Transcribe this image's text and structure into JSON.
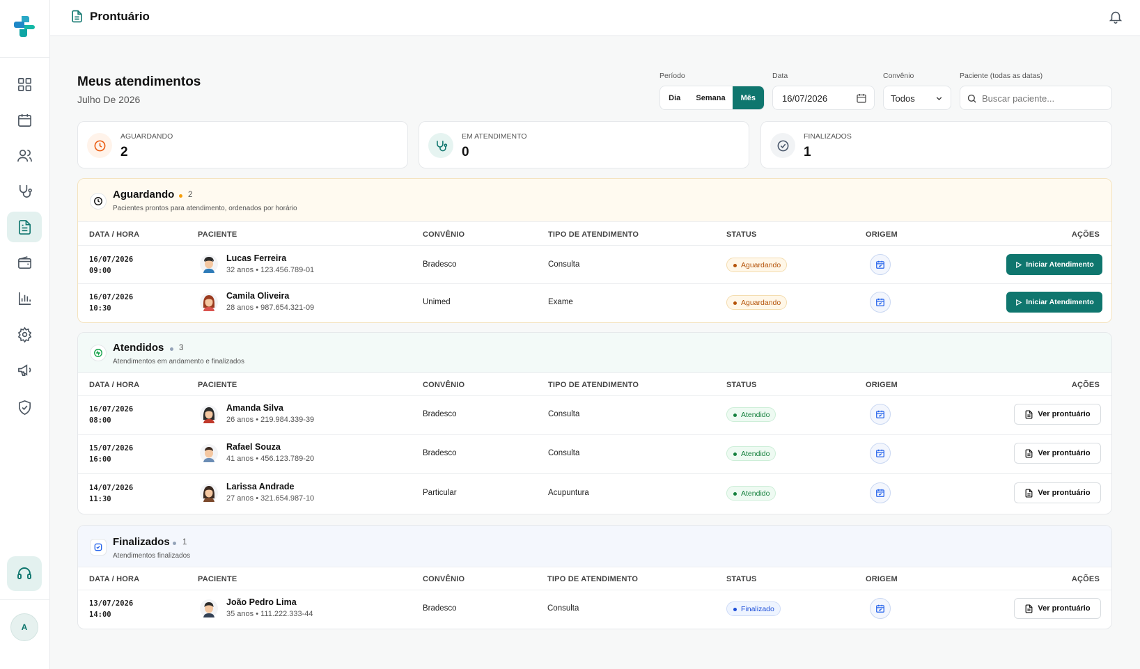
{
  "topbar": {
    "title": "Prontuário"
  },
  "sidebar": {
    "items": [
      "dashboard",
      "agenda",
      "pacientes",
      "atendimentos",
      "prontuario",
      "financeiro",
      "relatorios",
      "configuracoes",
      "campanhas",
      "seguranca"
    ],
    "avatar_initial": "A"
  },
  "header": {
    "title": "Meus atendimentos",
    "subtitle": "Julho De 2026"
  },
  "filters": {
    "periodo_label": "Período",
    "periodo_options": [
      "Dia",
      "Semana",
      "Mês"
    ],
    "periodo_selected": "Mês",
    "data_label": "Data",
    "data_value": "16/07/2026",
    "convenio_label": "Convênio",
    "convenio_value": "Todos",
    "paciente_label": "Paciente (todas as datas)",
    "paciente_placeholder": "Buscar paciente..."
  },
  "stats": [
    {
      "label": "AGUARDANDO",
      "value": "2",
      "color": "#ea580c"
    },
    {
      "label": "EM ATENDIMENTO",
      "value": "0",
      "color": "#0f766e"
    },
    {
      "label": "FINALIZADOS",
      "value": "1",
      "color": "#475569"
    }
  ],
  "columns": [
    "DATA / HORA",
    "PACIENTE",
    "CONVÊNIO",
    "TIPO DE ATENDIMENTO",
    "STATUS",
    "ORIGEM",
    "AÇÕES"
  ],
  "sections": [
    {
      "title": "Aguardando",
      "count": "2",
      "subtitle": "Pacientes prontos para atendimento, ordenados por horário",
      "rows": [
        {
          "date": "16/07/2026",
          "time": "09:00",
          "name": "Lucas Ferreira",
          "meta": "32 anos • 123.456.789-01",
          "convenio": "Bradesco",
          "tipo": "Consulta",
          "status": "Aguardando",
          "action": "Iniciar Atendimento"
        },
        {
          "date": "16/07/2026",
          "time": "10:30",
          "name": "Camila Oliveira",
          "meta": "28 anos • 987.654.321-09",
          "convenio": "Unimed",
          "tipo": "Exame",
          "status": "Aguardando",
          "action": "Iniciar Atendimento"
        }
      ]
    },
    {
      "title": "Atendidos",
      "count": "3",
      "subtitle": "Atendimentos em andamento e finalizados",
      "rows": [
        {
          "date": "16/07/2026",
          "time": "08:00",
          "name": "Amanda Silva",
          "meta": "26 anos • 219.984.339-39",
          "convenio": "Bradesco",
          "tipo": "Consulta",
          "status": "Atendido",
          "action": "Ver prontuário"
        },
        {
          "date": "15/07/2026",
          "time": "16:00",
          "name": "Rafael Souza",
          "meta": "41 anos • 456.123.789-20",
          "convenio": "Bradesco",
          "tipo": "Consulta",
          "status": "Atendido",
          "action": "Ver prontuário"
        },
        {
          "date": "14/07/2026",
          "time": "11:30",
          "name": "Larissa Andrade",
          "meta": "27 anos • 321.654.987-10",
          "convenio": "Particular",
          "tipo": "Acupuntura",
          "status": "Atendido",
          "action": "Ver prontuário"
        }
      ]
    },
    {
      "title": "Finalizados",
      "count": "1",
      "subtitle": "Atendimentos finalizados",
      "rows": [
        {
          "date": "13/07/2026",
          "time": "14:00",
          "name": "João Pedro Lima",
          "meta": "35 anos • 111.222.333-44",
          "convenio": "Bradesco",
          "tipo": "Consulta",
          "status": "Finalizado",
          "action": "Ver prontuário"
        }
      ]
    }
  ],
  "colors": {
    "brand": "#0f766e",
    "waiting": "#f59e0b",
    "attended": "#22c55e",
    "finished": "#2563eb"
  }
}
